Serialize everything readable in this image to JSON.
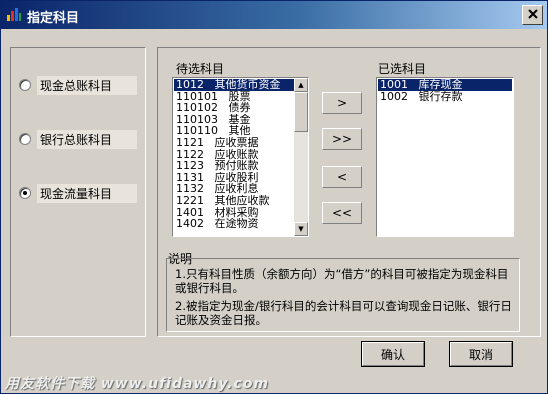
{
  "window": {
    "title": "指定科目",
    "title_icon": "bar-chart-icon",
    "close_icon": "close-icon"
  },
  "radios": [
    {
      "label": "现金总账科目",
      "checked": false
    },
    {
      "label": "银行总账科目",
      "checked": false
    },
    {
      "label": "现金流量科目",
      "checked": true
    }
  ],
  "pending": {
    "label": "待选科目",
    "items": [
      "1012   其他货币资金",
      "110101   股票",
      "110102   债券",
      "110103   基金",
      "110110   其他",
      "1121   应收票据",
      "1122   应收账款",
      "1123   预付账款",
      "1131   应收股利",
      "1132   应收利息",
      "1221   其他应收款",
      "1401   材料采购",
      "1402   在途物资"
    ],
    "selected_index": 0
  },
  "chosen": {
    "label": "已选科目",
    "items": [
      "1001   库存现金",
      "1002   银行存款"
    ],
    "selected_index": 0
  },
  "move_buttons": {
    "add_one": ">",
    "add_all": ">>",
    "remove_one": "<",
    "remove_all": "<<"
  },
  "description": {
    "label": "说明",
    "line1": "1.只有科目性质（余额方向）为“借方”的科目可被指定为现金科目或银行科目。",
    "line2": "2.被指定为现金/银行科目的会计科目可以查询现金日记账、银行日记账及资金日报。"
  },
  "buttons": {
    "ok": "确认",
    "cancel": "取消"
  },
  "watermark": "用友软件下载 www.ufidawhy.com"
}
